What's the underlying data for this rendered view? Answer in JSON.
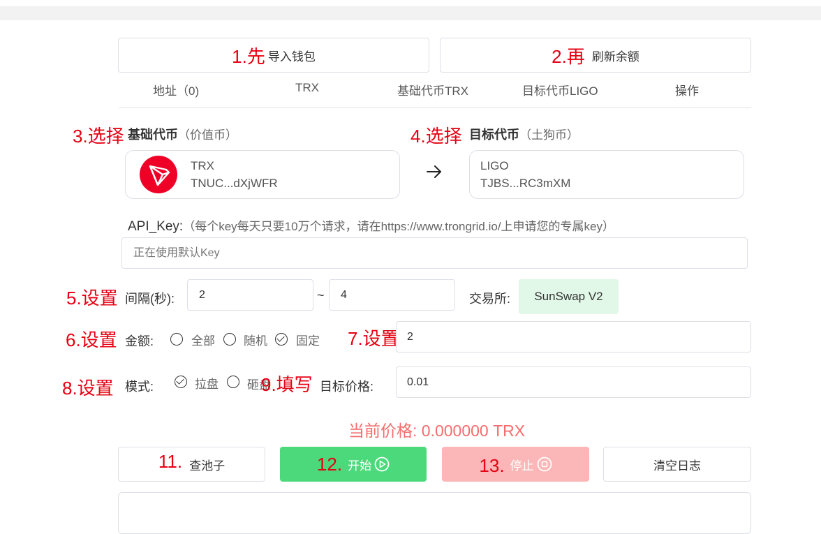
{
  "steps": {
    "s1": "1.先",
    "s2": "2.再",
    "s3": "3.选择",
    "s4": "4.选择",
    "s5": "5.设置",
    "s6": "6.设置",
    "s7": "7.设置",
    "s8": "8.设置",
    "s9": "9.填写",
    "s11": "11.",
    "s12": "12.",
    "s13": "13."
  },
  "toolbar": {
    "import_label": "导入钱包",
    "refresh_label": "刷新余额"
  },
  "table": {
    "columns": [
      "地址（0)",
      "TRX",
      "基础代币TRX",
      "目标代币LIGO",
      "操作"
    ]
  },
  "base": {
    "title": "基础代币",
    "hint": "（价值币）",
    "symbol": "TRX",
    "address": "TNUC...dXjWFR"
  },
  "target": {
    "title": "目标代币",
    "hint": "（土狗币）",
    "symbol": "LIGO",
    "address": "TJBS...RC3mXM"
  },
  "api": {
    "label": "API_Key:",
    "hint": "（每个key每天只要10万个请求，请在https://www.trongrid.io/上申请您的专属key）",
    "placeholder": "正在使用默认Key"
  },
  "interval": {
    "label": "间隔(秒):",
    "min": "2",
    "sep": "~",
    "max": "4"
  },
  "exchange": {
    "label": "交易所:",
    "value": "SunSwap V2"
  },
  "amount": {
    "label": "金额:",
    "options": [
      "全部",
      "随机",
      "固定"
    ],
    "selected": "固定",
    "value": "2"
  },
  "mode": {
    "label": "模式:",
    "options": [
      "拉盘",
      "砸盘"
    ],
    "selected": "拉盘"
  },
  "target_price": {
    "label": "目标价格:",
    "value": "0.01"
  },
  "current_price": "当前价格: 0.000000 TRX",
  "actions": {
    "pool": "查池子",
    "start": "开始",
    "stop": "停止",
    "clear": "清空日志"
  },
  "colors": {
    "step": "#e60012",
    "start": "#4cd97b",
    "stop": "#fbb7b7",
    "price": "#f56c6c",
    "exchange_bg": "#e1f7e7",
    "tron_red": "#ef0027"
  }
}
